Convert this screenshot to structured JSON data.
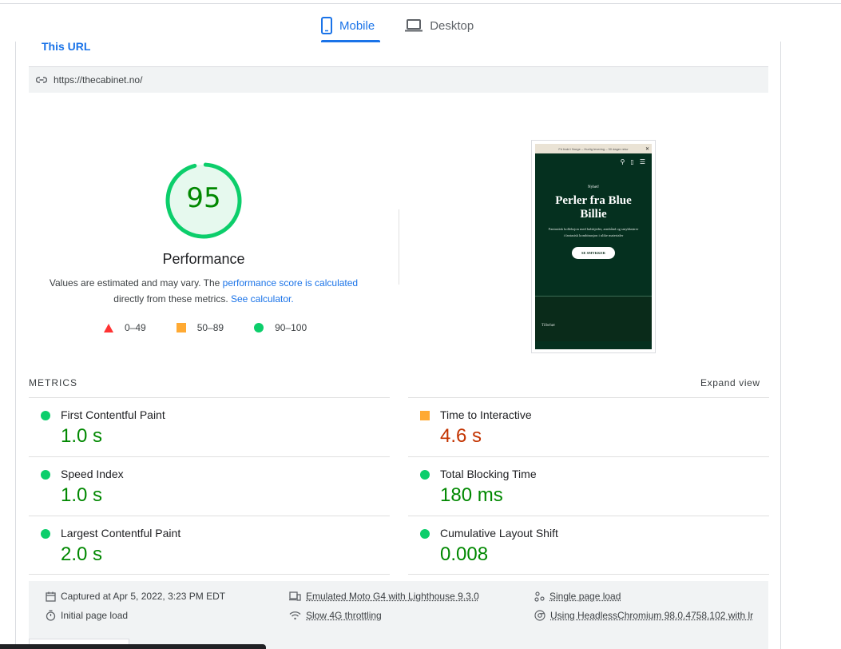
{
  "device_tabs": [
    {
      "label": "Mobile",
      "icon": "smartphone-icon",
      "active": true
    },
    {
      "label": "Desktop",
      "icon": "laptop-icon",
      "active": false
    }
  ],
  "url_section": {
    "tab_label": "This URL",
    "url": "https://thecabinet.no/",
    "icon": "link-icon"
  },
  "performance": {
    "score": "95",
    "score_fraction": 0.95,
    "title": "Performance",
    "desc_part1": "Values are estimated and may vary. The ",
    "desc_link1": "performance score is calculated",
    "desc_part2": " directly from these metrics. ",
    "desc_link2": "See calculator.",
    "legend": [
      {
        "shape": "triangle",
        "label": "0–49",
        "color": "#ff3333"
      },
      {
        "shape": "square",
        "label": "50–89",
        "color": "#ffaa33"
      },
      {
        "shape": "circle",
        "label": "90–100",
        "color": "#0cce6b"
      }
    ]
  },
  "screenshot": {
    "banner": "Fri frakt i Norge – Hurtig levering – 30 dager retur",
    "kicker": "Nyhet!",
    "title": "Perler fra Blue Billie",
    "subtitle": "Fantastisk kolleksjon med halskjeder, armbånd og smykkeører i fantasisk kombinasjon i ulike materialer",
    "button": "SE SMYKKER",
    "footer": "Tilbehør"
  },
  "metrics": {
    "label": "METRICS",
    "expand_label": "Expand view",
    "items": [
      {
        "name": "First Contentful Paint",
        "value": "1.0 s",
        "rating": "good"
      },
      {
        "name": "Time to Interactive",
        "value": "4.6 s",
        "rating": "average"
      },
      {
        "name": "Speed Index",
        "value": "1.0 s",
        "rating": "good"
      },
      {
        "name": "Total Blocking Time",
        "value": "180 ms",
        "rating": "good"
      },
      {
        "name": "Largest Contentful Paint",
        "value": "2.0 s",
        "rating": "good"
      },
      {
        "name": "Cumulative Layout Shift",
        "value": "0.008",
        "rating": "good"
      }
    ]
  },
  "run_info": {
    "captured": "Captured at Apr 5, 2022, 3:23 PM EDT",
    "initial_load": "Initial page load",
    "device": "Emulated Moto G4 with Lighthouse 9.3.0",
    "throttling": "Slow 4G throttling",
    "single_load": "Single page load",
    "browser": "Using HeadlessChromium 98.0.4758.102 with lr"
  },
  "colors": {
    "accent": "#1a73e8",
    "pass": "#0cce6b",
    "pass_text": "#008800",
    "average": "#ffaa33",
    "average_text": "#c33300",
    "fail": "#ff3333"
  }
}
